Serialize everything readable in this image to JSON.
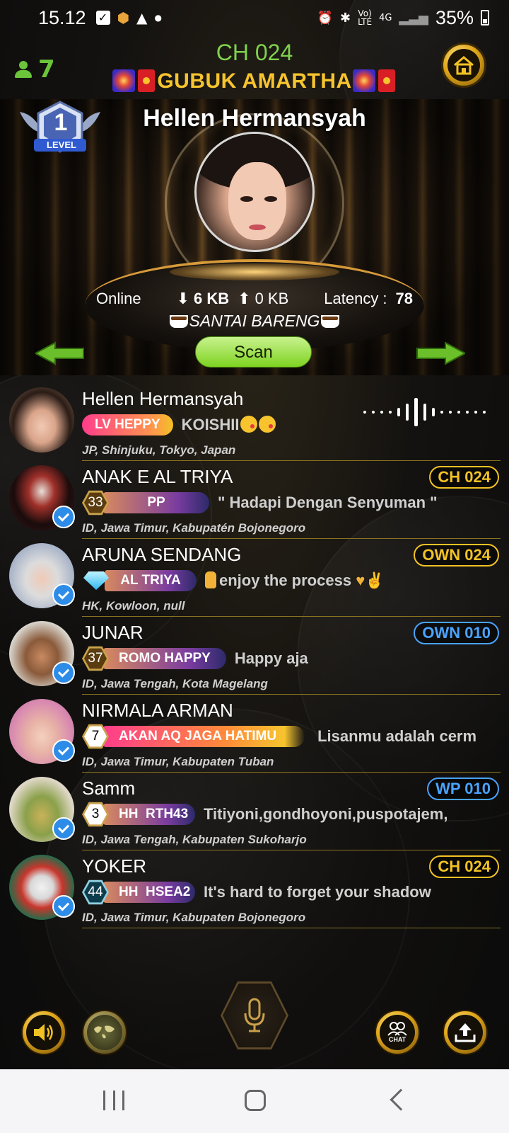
{
  "status_bar": {
    "time": "15.12",
    "battery": "35%"
  },
  "header": {
    "user_count": "7",
    "channel": "CH 024",
    "room_name": "GUBUK AMARTHA"
  },
  "stage": {
    "level_number": "1",
    "level_label": "LEVEL",
    "host_name": "Hellen Hermansyah",
    "online_label": "Online",
    "download": "6 KB",
    "upload": "0 KB",
    "latency_label": "Latency :",
    "latency_value": "78",
    "mood": "SANTAI BARENG",
    "scan_label": "Scan"
  },
  "users": [
    {
      "name": "Hellen Hermansyah",
      "badge": "LV HEPPY",
      "status": "KOISHII",
      "location": "JP, Shinjuku, Tokyo, Japan",
      "tag": ""
    },
    {
      "name": "ANAK E AL TRIYA",
      "level": "33",
      "badge": "PP",
      "status": "\" Hadapi Dengan Senyuman \"",
      "location": "ID, Jawa Timur, Kabupatén Bojonegoro",
      "tag": "CH 024"
    },
    {
      "name": "ARUNA SENDANG",
      "badge": "AL TRIYA",
      "status": "enjoy the process",
      "location": "HK, Kowloon, null",
      "tag": "OWN 024"
    },
    {
      "name": "JUNAR",
      "level": "37",
      "badge": "ROMO HAPPY",
      "status": "Happy aja",
      "location": "ID, Jawa Tengah, Kota Magelang",
      "tag": "OWN 010"
    },
    {
      "name": "NIRMALA ARMAN",
      "level": "7",
      "badge": "AKAN AQ JAGA HATIMU",
      "status": "Lisanmu adalah cerm",
      "location": "ID, Jawa Timur, Kabupaten Tuban",
      "tag": ""
    },
    {
      "name": "Samm",
      "level": "3",
      "badge": "HH  RTH43",
      "status": "Titiyoni,gondhoyoni,puspotajem,",
      "location": "ID, Jawa Tengah, Kabupaten Sukoharjo",
      "tag": "WP 010"
    },
    {
      "name": "YOKER",
      "level": "44",
      "badge": "HH  HSEA2",
      "status": "It's hard to forget your shadow",
      "location": "ID, Jawa Timur, Kabupaten Bojonegoro",
      "tag": "CH 024"
    }
  ],
  "controls": {
    "chat_label": "CHAT"
  },
  "colors": {
    "accent_gold": "#f2c224",
    "accent_green": "#7ed321",
    "tag_blue": "#4aa3ff",
    "verify_blue": "#2d8ce8"
  }
}
